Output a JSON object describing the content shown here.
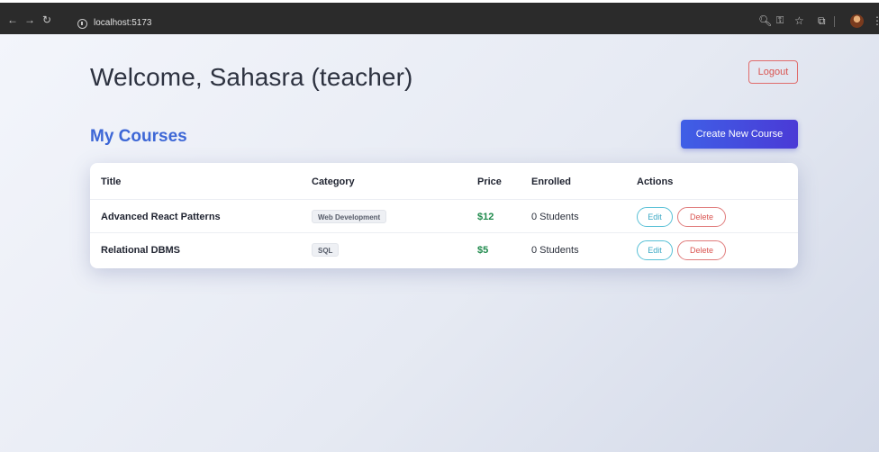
{
  "browser": {
    "url": "localhost:5173",
    "nav": {
      "back": "←",
      "forward": "→",
      "reload": "↻"
    },
    "icons": [
      "zoom-icon",
      "password-key-icon",
      "bookmark-star-icon",
      "extensions-icon",
      "profile-avatar",
      "menu-icon"
    ]
  },
  "header": {
    "welcome": "Welcome, Sahasra (teacher)",
    "logout_label": "Logout"
  },
  "courses": {
    "title": "My Courses",
    "create_label": "Create New Course",
    "columns": [
      "Title",
      "Category",
      "Price",
      "Enrolled",
      "Actions"
    ],
    "rows": [
      {
        "title": "Advanced React Patterns",
        "category": "Web Development",
        "price": "$12",
        "enrolled": "0 Students",
        "edit": "Edit",
        "delete": "Delete"
      },
      {
        "title": "Relational DBMS",
        "category": "SQL",
        "price": "$5",
        "enrolled": "0 Students",
        "edit": "Edit",
        "delete": "Delete"
      }
    ]
  },
  "colors": {
    "accent": "#3d67d6",
    "primary_button": "#4a4fe0",
    "price": "#1f8a4c",
    "danger": "#d9534f",
    "info": "#3aa8c4"
  }
}
